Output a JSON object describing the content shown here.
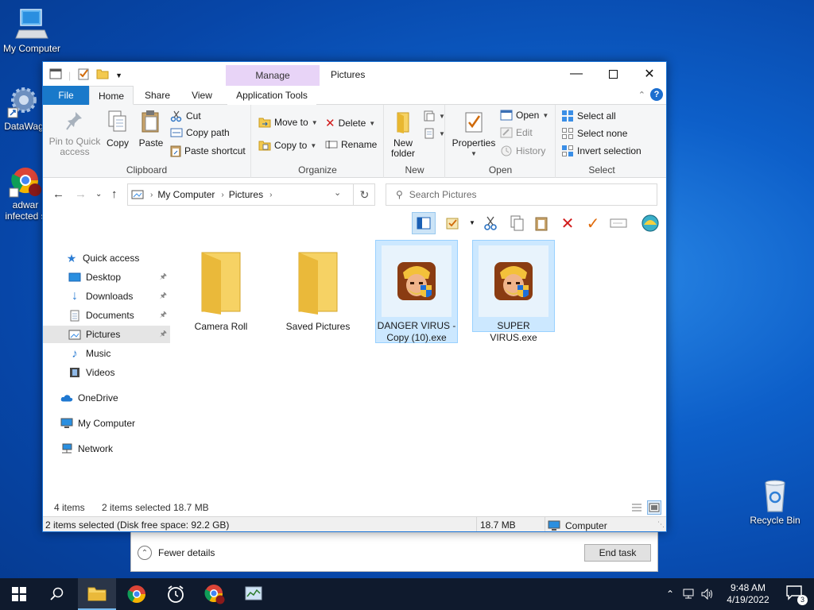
{
  "desktop": {
    "icons": [
      {
        "label": "My Computer"
      },
      {
        "label": "DataWag"
      },
      {
        "label_line1": "adwar",
        "label_line2": "infected s"
      },
      {
        "label": "Recycle Bin"
      }
    ]
  },
  "task_manager": {
    "fewer_details": "Fewer details",
    "end_task": "End task"
  },
  "explorer": {
    "title": "Pictures",
    "manage_tab": "Manage",
    "tabs": {
      "file": "File",
      "home": "Home",
      "share": "Share",
      "view": "View",
      "application_tools": "Application Tools"
    },
    "ribbon": {
      "clipboard": {
        "group": "Clipboard",
        "pin_line1": "Pin to Quick",
        "pin_line2": "access",
        "copy": "Copy",
        "paste": "Paste",
        "cut": "Cut",
        "copy_path": "Copy path",
        "paste_shortcut": "Paste shortcut"
      },
      "organize": {
        "group": "Organize",
        "move_to": "Move to",
        "copy_to": "Copy to",
        "delete": "Delete",
        "rename": "Rename"
      },
      "new": {
        "group": "New",
        "new_folder_line1": "New",
        "new_folder_line2": "folder"
      },
      "open": {
        "group": "Open",
        "properties": "Properties",
        "open": "Open",
        "edit": "Edit",
        "history": "History"
      },
      "select": {
        "group": "Select",
        "select_all": "Select all",
        "select_none": "Select none",
        "invert_selection": "Invert selection"
      }
    },
    "address": {
      "segments": [
        "My Computer",
        "Pictures"
      ]
    },
    "search": {
      "placeholder": "Search Pictures"
    },
    "nav_pane": {
      "quick_access": "Quick access",
      "desktop": "Desktop",
      "downloads": "Downloads",
      "documents": "Documents",
      "pictures": "Pictures",
      "music": "Music",
      "videos": "Videos",
      "onedrive": "OneDrive",
      "my_computer": "My Computer",
      "network": "Network"
    },
    "files": [
      {
        "name": "Camera Roll",
        "type": "folder",
        "selected": false
      },
      {
        "name": "Saved Pictures",
        "type": "folder",
        "selected": false
      },
      {
        "name_line1": "DANGER VIRUS -",
        "name_line2": "Copy (10).exe",
        "type": "exe",
        "selected": true
      },
      {
        "name": "SUPER VIRUS.exe",
        "type": "exe",
        "selected": true
      }
    ],
    "status": {
      "count": "4 items",
      "selected": "2 items selected",
      "size": "18.7 MB"
    },
    "details_bar": {
      "summary": "2 items selected (Disk free space: 92.2 GB)",
      "size": "18.7 MB",
      "location": "Computer"
    }
  },
  "taskbar": {
    "time": "9:48 AM",
    "date": "4/19/2022",
    "notification_count": "3"
  },
  "colors": {
    "accent": "#1979ca",
    "selection": "#cce8ff",
    "manage": "#e8d4f7",
    "taskbar": "#0f1a2d"
  }
}
